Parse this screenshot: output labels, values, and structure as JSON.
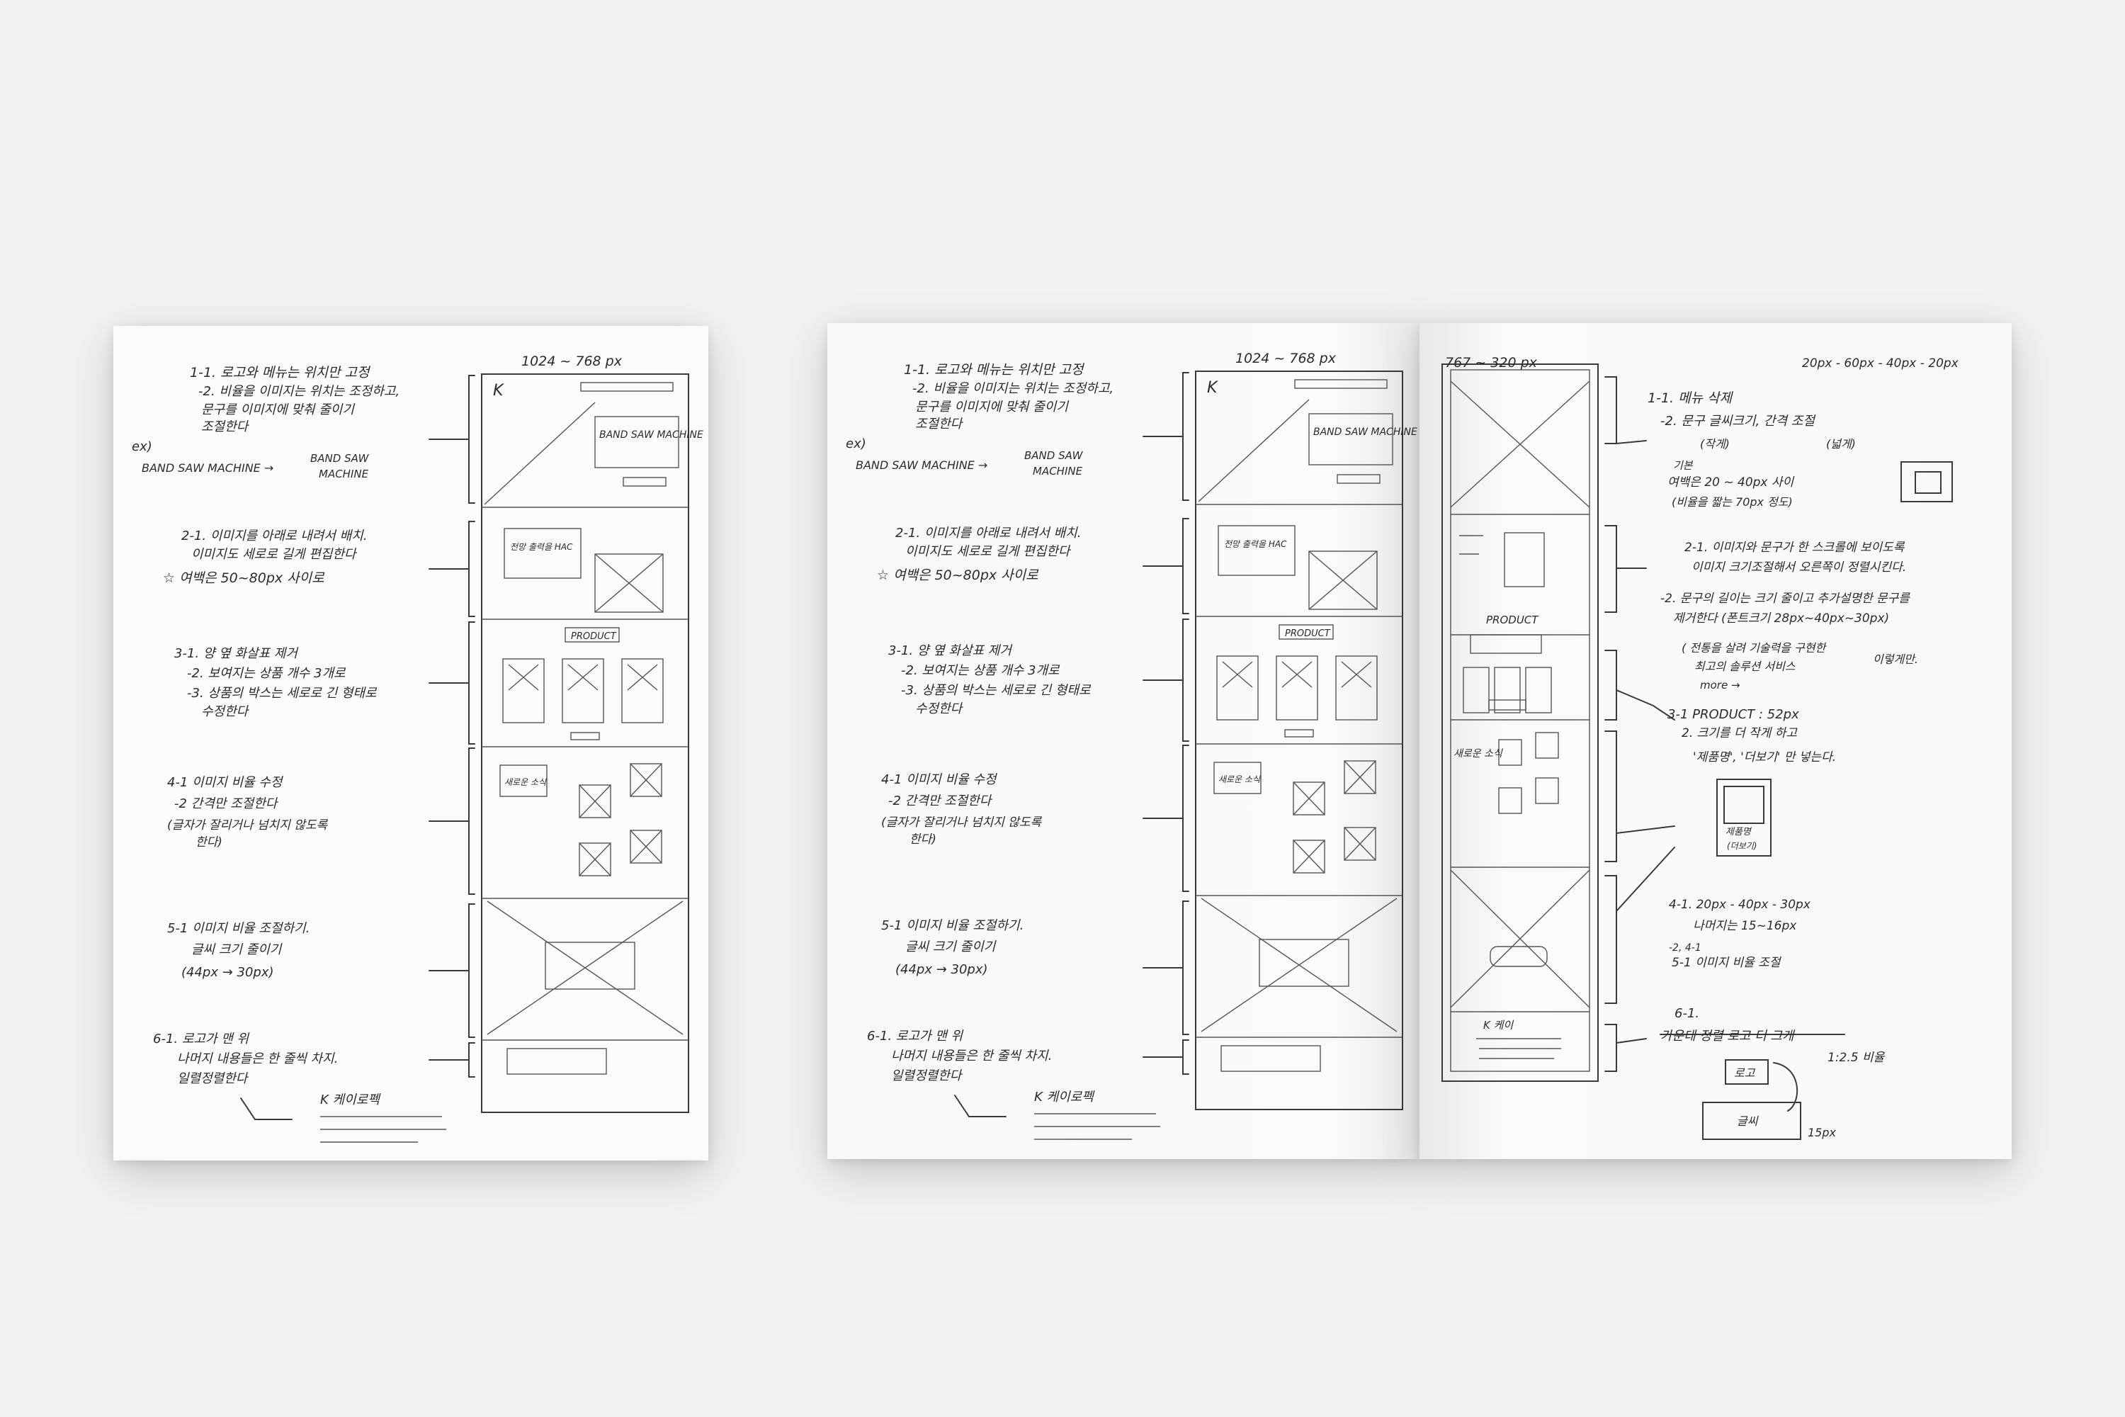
{
  "notes_main": [
    {
      "id": "n1a",
      "text": "1-1. 로고와 메뉴는 위치만 고정"
    },
    {
      "id": "n1b",
      "text": "-2. 비율을 이미지는 위치는 조정하고,"
    },
    {
      "id": "n1c",
      "text": "문구를 이미지에 맞춰 줄이기"
    },
    {
      "id": "n1d",
      "text": "조절한다"
    },
    {
      "id": "ex1",
      "text": "ex)"
    },
    {
      "id": "ex2",
      "text": "BAND SAW MACHINE →"
    },
    {
      "id": "ex3",
      "text": "BAND SAW"
    },
    {
      "id": "ex4",
      "text": "MACHINE"
    },
    {
      "id": "n2a",
      "text": "2-1. 이미지를 아래로 내려서 배치."
    },
    {
      "id": "n2b",
      "text": "이미지도 세로로 길게 편집한다"
    },
    {
      "id": "n2c",
      "text": "☆ 여백은 50~80px 사이로"
    },
    {
      "id": "n3a",
      "text": "3-1. 양 옆 화살표 제거"
    },
    {
      "id": "n3b",
      "text": "-2. 보여지는 상품 개수 3개로"
    },
    {
      "id": "n3c",
      "text": "-3. 상품의 박스는 세로로 긴 형태로"
    },
    {
      "id": "n3d",
      "text": "수정한다"
    },
    {
      "id": "n4a",
      "text": "4-1 이미지 비율 수정"
    },
    {
      "id": "n4b",
      "text": "-2 간격만 조절한다"
    },
    {
      "id": "n4c",
      "text": "(글자가 잘리거나 넘치지 않도록"
    },
    {
      "id": "n4d",
      "text": "한다)"
    },
    {
      "id": "n5a",
      "text": "5-1 이미지 비율 조절하기."
    },
    {
      "id": "n5b",
      "text": "글씨 크기 줄이기"
    },
    {
      "id": "n5c",
      "text": "(44px → 30px)"
    },
    {
      "id": "n6a",
      "text": "6-1. 로고가 맨 위"
    },
    {
      "id": "n6b",
      "text": "나머지 내용들은 한 줄씩 차지."
    },
    {
      "id": "n6c",
      "text": "일렬정렬한다"
    },
    {
      "id": "foot",
      "text": "K 케이로펙"
    }
  ],
  "wireframe_main": {
    "size_label": "1024 ~ 768 px",
    "logo": "K",
    "hero_text": "BAND SAW MACHINE",
    "s2_text": "전망 출력을 HAC",
    "product": "PRODUCT",
    "s4_text": "새로운 소식"
  },
  "notes_right": [
    {
      "id": "r0",
      "text": "767 ~ 320 px"
    },
    {
      "id": "r0b",
      "text": "20px - 60px - 40px - 20px"
    },
    {
      "id": "r1a",
      "text": "1-1. 메뉴 삭제"
    },
    {
      "id": "r1b",
      "text": "-2. 문구 글씨크기, 간격 조절"
    },
    {
      "id": "r1c",
      "text": "(작게)"
    },
    {
      "id": "r1d",
      "text": "(넓게)"
    },
    {
      "id": "r1e",
      "text": "기본"
    },
    {
      "id": "r1f",
      "text": "여백은 20 ~ 40px 사이"
    },
    {
      "id": "r1g",
      "text": "(비율을 짧는 70px 정도)"
    },
    {
      "id": "r2a",
      "text": "2-1. 이미지와 문구가 한 스크롤에 보이도록"
    },
    {
      "id": "r2b",
      "text": "이미지 크기조절해서 오른쪽이 정렬시킨다."
    },
    {
      "id": "r2c",
      "text": "-2. 문구의 길이는 크기 줄이고 추가설명한 문구를"
    },
    {
      "id": "r2d",
      "text": "제거한다 (폰트크기 28px~40px~30px)"
    },
    {
      "id": "r2e",
      "text": "( 전통을 살려 기술력을 구현한"
    },
    {
      "id": "r2f",
      "text": "최고의 솔루션 서비스"
    },
    {
      "id": "r2g",
      "text": "more →"
    },
    {
      "id": "r2h",
      "text": "이렇게만."
    },
    {
      "id": "r3a",
      "text": "3-1 PRODUCT : 52px"
    },
    {
      "id": "r3b",
      "text": "2. 크기를 더 작게 하고"
    },
    {
      "id": "r3c",
      "text": "'제품명', '더보기' 만 넣는다."
    },
    {
      "id": "r3d",
      "text": "제품명"
    },
    {
      "id": "r3e",
      "text": "(더보기)"
    },
    {
      "id": "r4a",
      "text": "4-1. 20px - 40px - 30px"
    },
    {
      "id": "r4b",
      "text": "나머지는 15~16px"
    },
    {
      "id": "r4c",
      "text": "5-1 이미지 비율 조절"
    },
    {
      "id": "r4d",
      "text": "-2, 4-1"
    },
    {
      "id": "r6a",
      "text": "6-1."
    },
    {
      "id": "r6b",
      "text": "가운데 정렬 로고 더 크게"
    },
    {
      "id": "r6c",
      "text": "1:2.5 비율"
    },
    {
      "id": "r6d",
      "text": "로고"
    },
    {
      "id": "r6e",
      "text": "글씨"
    },
    {
      "id": "r6f",
      "text": "15px"
    },
    {
      "id": "rk",
      "text": "K 케이"
    },
    {
      "id": "rprod",
      "text": "PRODUCT"
    },
    {
      "id": "rnews",
      "text": "새로운 소식"
    }
  ]
}
